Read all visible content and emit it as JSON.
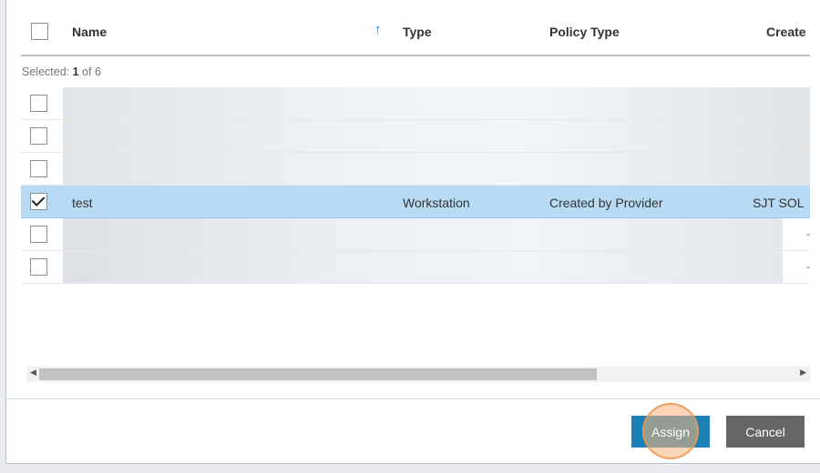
{
  "table": {
    "columns": {
      "name": "Name",
      "type": "Type",
      "policy_type": "Policy Type",
      "created": "Create"
    },
    "sort": {
      "column": "Name",
      "direction": "ascending"
    },
    "selected_prefix": "Selected:",
    "selected_count": "1",
    "selected_suffix": "of 6",
    "rows": [
      {
        "checked": false,
        "name": "",
        "type": "",
        "policy_type": "",
        "created": "",
        "redacted": true
      },
      {
        "checked": false,
        "name": "",
        "type": "",
        "policy_type": "",
        "created": "",
        "redacted": true
      },
      {
        "checked": false,
        "name": "",
        "type": "",
        "policy_type": "",
        "created": "",
        "redacted": true
      },
      {
        "checked": true,
        "name": "test",
        "type": "Workstation",
        "policy_type": "Created by Provider",
        "created": "SJT SOL"
      },
      {
        "checked": false,
        "name": "",
        "type": "",
        "policy_type": "",
        "created": "-",
        "redacted": true
      },
      {
        "checked": false,
        "name": "",
        "type": "",
        "policy_type": "",
        "created": "-",
        "redacted": true
      }
    ]
  },
  "scrollbar": {
    "position_fraction": 0.0,
    "visible_fraction": 0.72
  },
  "footer": {
    "assign_label": "Assign",
    "cancel_label": "Cancel"
  },
  "colors": {
    "accent": "#1d80b6",
    "selected_row": "#b7dbf5",
    "cancel": "#666666"
  },
  "icons": {
    "sort": "arrow-up-icon",
    "scroll_left": "arrow-left-icon",
    "scroll_right": "arrow-right-icon"
  }
}
